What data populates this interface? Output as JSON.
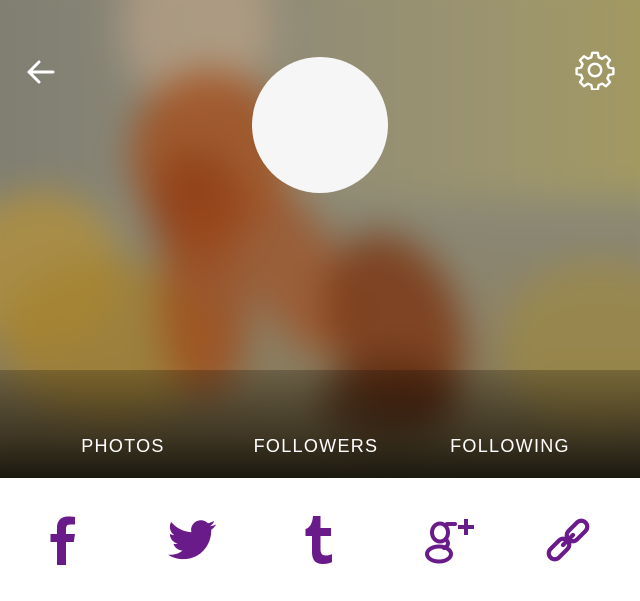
{
  "header": {
    "back_icon": "arrow-left-icon",
    "settings_icon": "gear-icon"
  },
  "profile": {
    "avatar_color": "#f6f6f6"
  },
  "stats": {
    "photos_label": "PHOTOS",
    "followers_label": "FOLLOWERS",
    "following_label": "FOLLOWING"
  },
  "social": {
    "accent_color": "#6a1b8a",
    "items": [
      {
        "icon": "facebook-icon"
      },
      {
        "icon": "twitter-icon"
      },
      {
        "icon": "tumblr-icon"
      },
      {
        "icon": "google-plus-icon"
      },
      {
        "icon": "link-icon"
      }
    ]
  }
}
